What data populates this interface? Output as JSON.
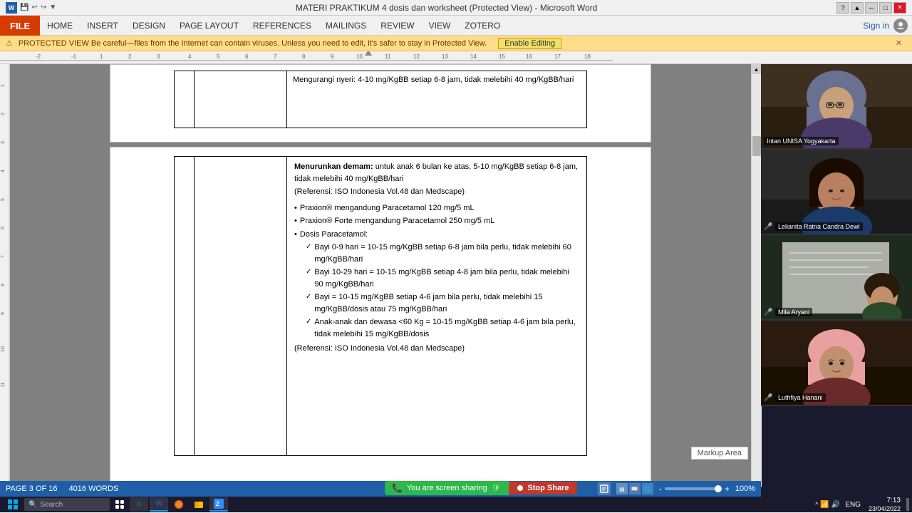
{
  "title_bar": {
    "title": "MATERI PRAKTIKUM 4 dosis dan worksheet (Protected View) - Microsoft Word",
    "help": "?",
    "restore": "🗗",
    "minimize": "─",
    "maximize": "□",
    "close": "✕"
  },
  "ribbon": {
    "file_label": "FILE",
    "menu_items": [
      "HOME",
      "INSERT",
      "DESIGN",
      "PAGE LAYOUT",
      "REFERENCES",
      "MAILINGS",
      "REVIEW",
      "VIEW",
      "ZOTERO"
    ],
    "sign_in": "Sign in"
  },
  "ruler": {
    "ticks": [
      "-2",
      "-1",
      "1",
      "2",
      "3",
      "4",
      "5",
      "6",
      "7",
      "8",
      "9",
      "10",
      "11",
      "12",
      "13",
      "14",
      "15",
      "16",
      "17",
      "18"
    ]
  },
  "document": {
    "top_content": "Mengurangi nyeri: 4-10 mg/KgBB setiap 6-8 jam, tidak melebihi 40 mg/KgBB/hari",
    "content_lines": [
      {
        "type": "heading",
        "text": "Menurunkan demam: untuk anak 6 bulan ke atas, 5-10 mg/KgBB setiap 6-8 jam, tidak melebihi 40 mg/KgBB/hari"
      },
      {
        "type": "note",
        "text": "(Referensi: ISO Indonesia Vol.48 dan Medscape)"
      },
      {
        "type": "bullet",
        "text": "Praxion® mengandung Paracetamol 120 mg/5 mL"
      },
      {
        "type": "bullet",
        "text": "Praxion® Forte mengandung Paracetamol 250 mg/5 mL"
      },
      {
        "type": "bullet",
        "text": "Dosis Paracetamol:"
      },
      {
        "type": "check",
        "text": "Bayi 0-9 hari = 10-15 mg/KgBB setiap 6-8 jam bila perlu, tidak melebihi 60 mg/KgBB/hari"
      },
      {
        "type": "check",
        "text": "Bayi 10-29 hari = 10-15 mg/KgBB setiap 4-8 jam bila perlu, tidak melebihi 90 mg/KgBB/hari"
      },
      {
        "type": "check",
        "text": "Bayi = 10-15 mg/KgBB setiap 4-6 jam bila perlu, tidak melebihi 15 mg/KgBB/dosis atau 75 mg/KgBB/hari"
      },
      {
        "type": "check",
        "text": "Anak-anak dan dewasa <60 Kg = 10-15 mg/KgBB setiap 4-6 jam bila perlu, tidak melebihi 15 mg/KgBB/dosis"
      },
      {
        "type": "note",
        "text": "(Referensi: ISO Indonesia Vol.48 dan Medscape)"
      }
    ]
  },
  "participants": [
    {
      "name": "Intan UNISA Yogyakarta",
      "has_video": true,
      "mic": false,
      "bg_color": "#3d3520"
    },
    {
      "name": "Lelianita Ratna Candra Dewi",
      "has_video": true,
      "mic": true,
      "bg_color": "#2a2a2a"
    },
    {
      "name": "Mila Aryani",
      "has_video": true,
      "mic": true,
      "bg_color": "#1e2a1e"
    },
    {
      "name": "Luthfiya Hanani",
      "has_video": true,
      "mic": true,
      "bg_color": "#2a1e1e"
    }
  ],
  "markup_area": {
    "label": "Markup Area"
  },
  "status_bar": {
    "page_info": "PAGE 3 OF 16",
    "words": "4016 WORDS",
    "zoom": "100%"
  },
  "screen_share": {
    "sharing_text": "You are screen sharing",
    "stop_text": "Stop Share"
  },
  "taskbar": {
    "time": "7:13",
    "date": "23/04/2022",
    "lang": "ENG"
  }
}
